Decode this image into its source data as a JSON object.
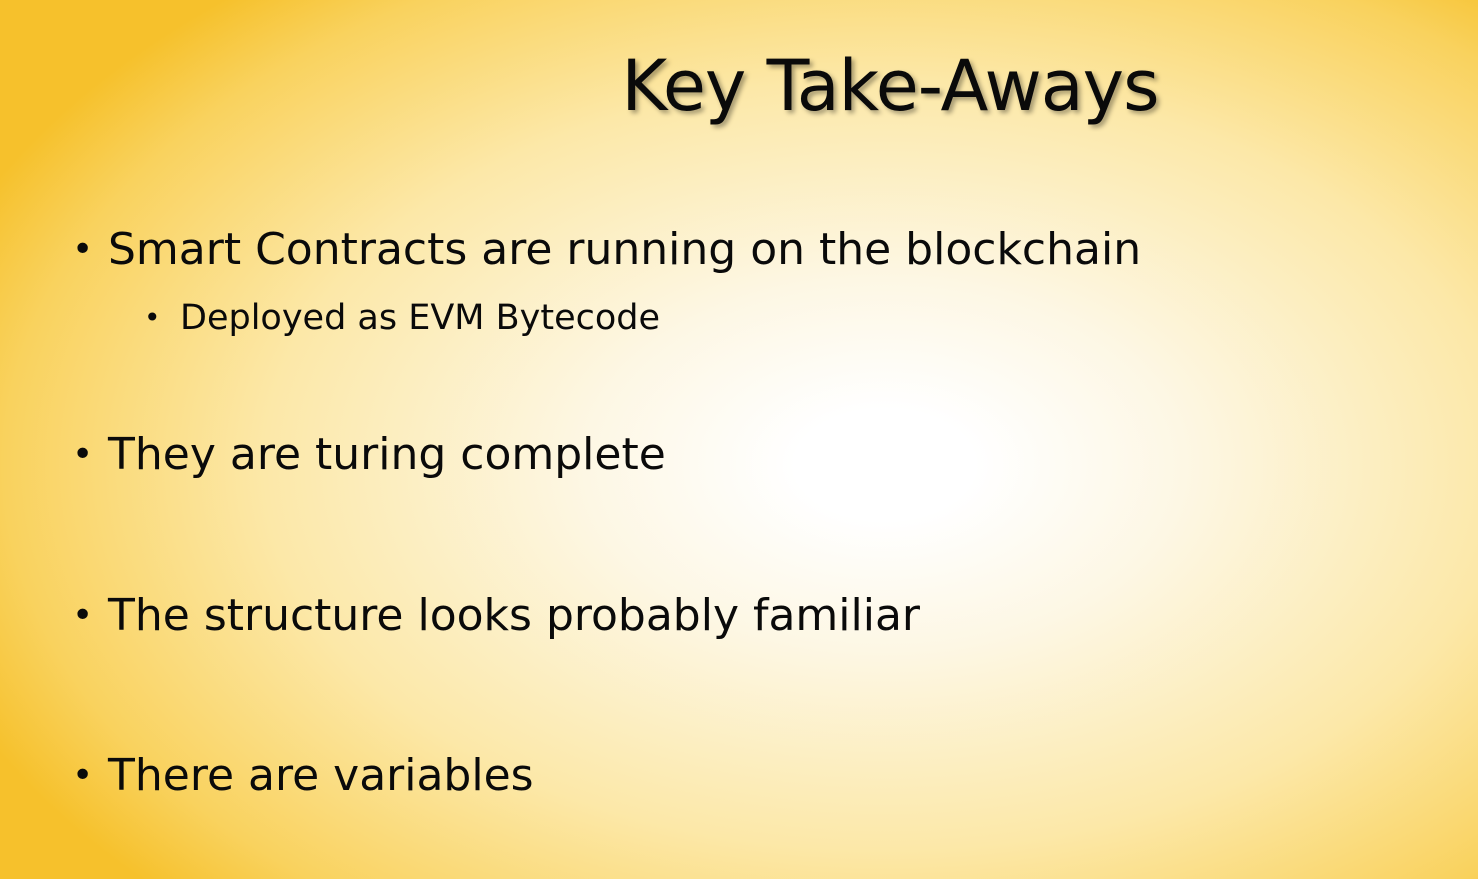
{
  "slide": {
    "title": "Key Take-Aways",
    "bullet_glyph": "•",
    "bullets": [
      {
        "text": "Smart Contracts are running on the blockchain",
        "sub_bullets": [
          "Deployed as EVM Bytecode"
        ]
      },
      {
        "text": "They are turing complete"
      },
      {
        "text": "The structure looks probably familiar"
      },
      {
        "text": "There are variables"
      }
    ]
  },
  "colors": {
    "background_center": "#ffffff",
    "background_edge": "#f6c12c",
    "text": "#0a0a0a"
  }
}
